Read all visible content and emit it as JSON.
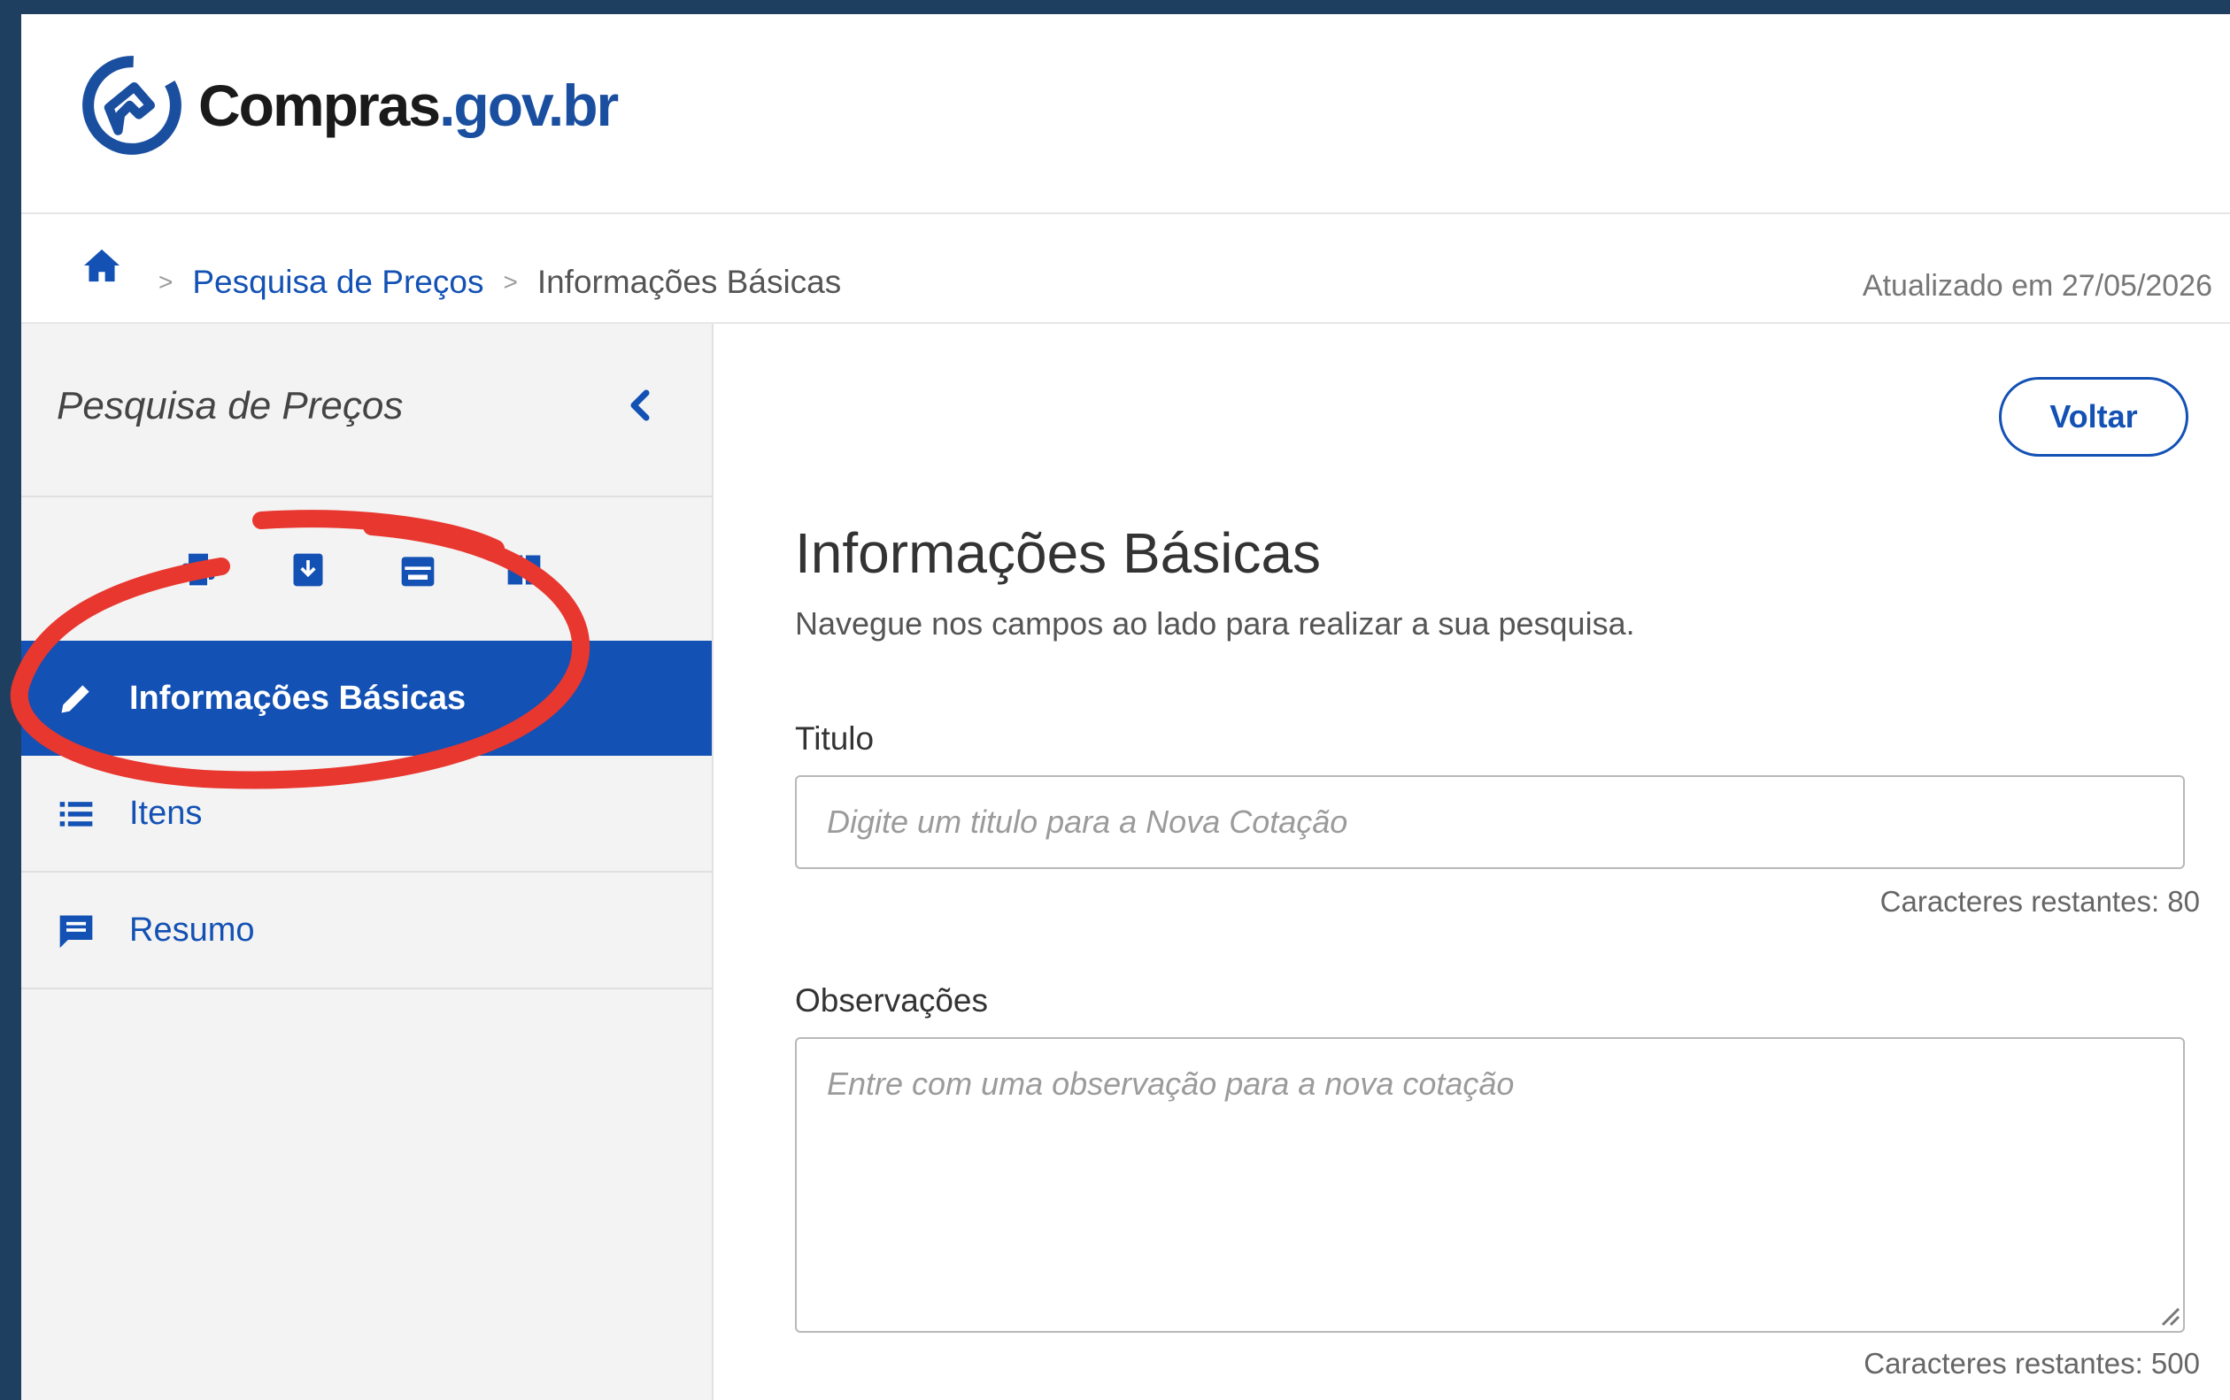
{
  "header": {
    "logo_text_main": "Compras",
    "logo_text_domain": ".gov.br"
  },
  "breadcrumb": {
    "items": [
      "Pesquisa de Preços",
      "Informações Básicas"
    ],
    "updated": "Atualizado em 27/05/2026"
  },
  "sidebar": {
    "title": "Pesquisa de Preços",
    "tools": [
      "print-icon",
      "download-icon",
      "calendar-icon",
      "book-icon"
    ],
    "items": [
      {
        "label": "Informações Básicas",
        "icon": "pencil-icon",
        "active": true
      },
      {
        "label": "Itens",
        "icon": "list-icon",
        "active": false
      },
      {
        "label": "Resumo",
        "icon": "comment-icon",
        "active": false
      }
    ]
  },
  "main": {
    "back_label": "Voltar",
    "title": "Informações Básicas",
    "subtitle": "Navegue nos campos ao lado para realizar a sua pesquisa.",
    "titulo_label": "Titulo",
    "titulo_placeholder": "Digite um titulo para a Nova Cotação",
    "titulo_counter": "Caracteres restantes: 80",
    "obs_label": "Observações",
    "obs_placeholder": "Entre com uma observação para a nova cotação",
    "obs_counter": "Caracteres restantes: 500"
  },
  "colors": {
    "primary": "#1351b4",
    "frame": "#1f3f60",
    "annotation": "#e8372f"
  }
}
